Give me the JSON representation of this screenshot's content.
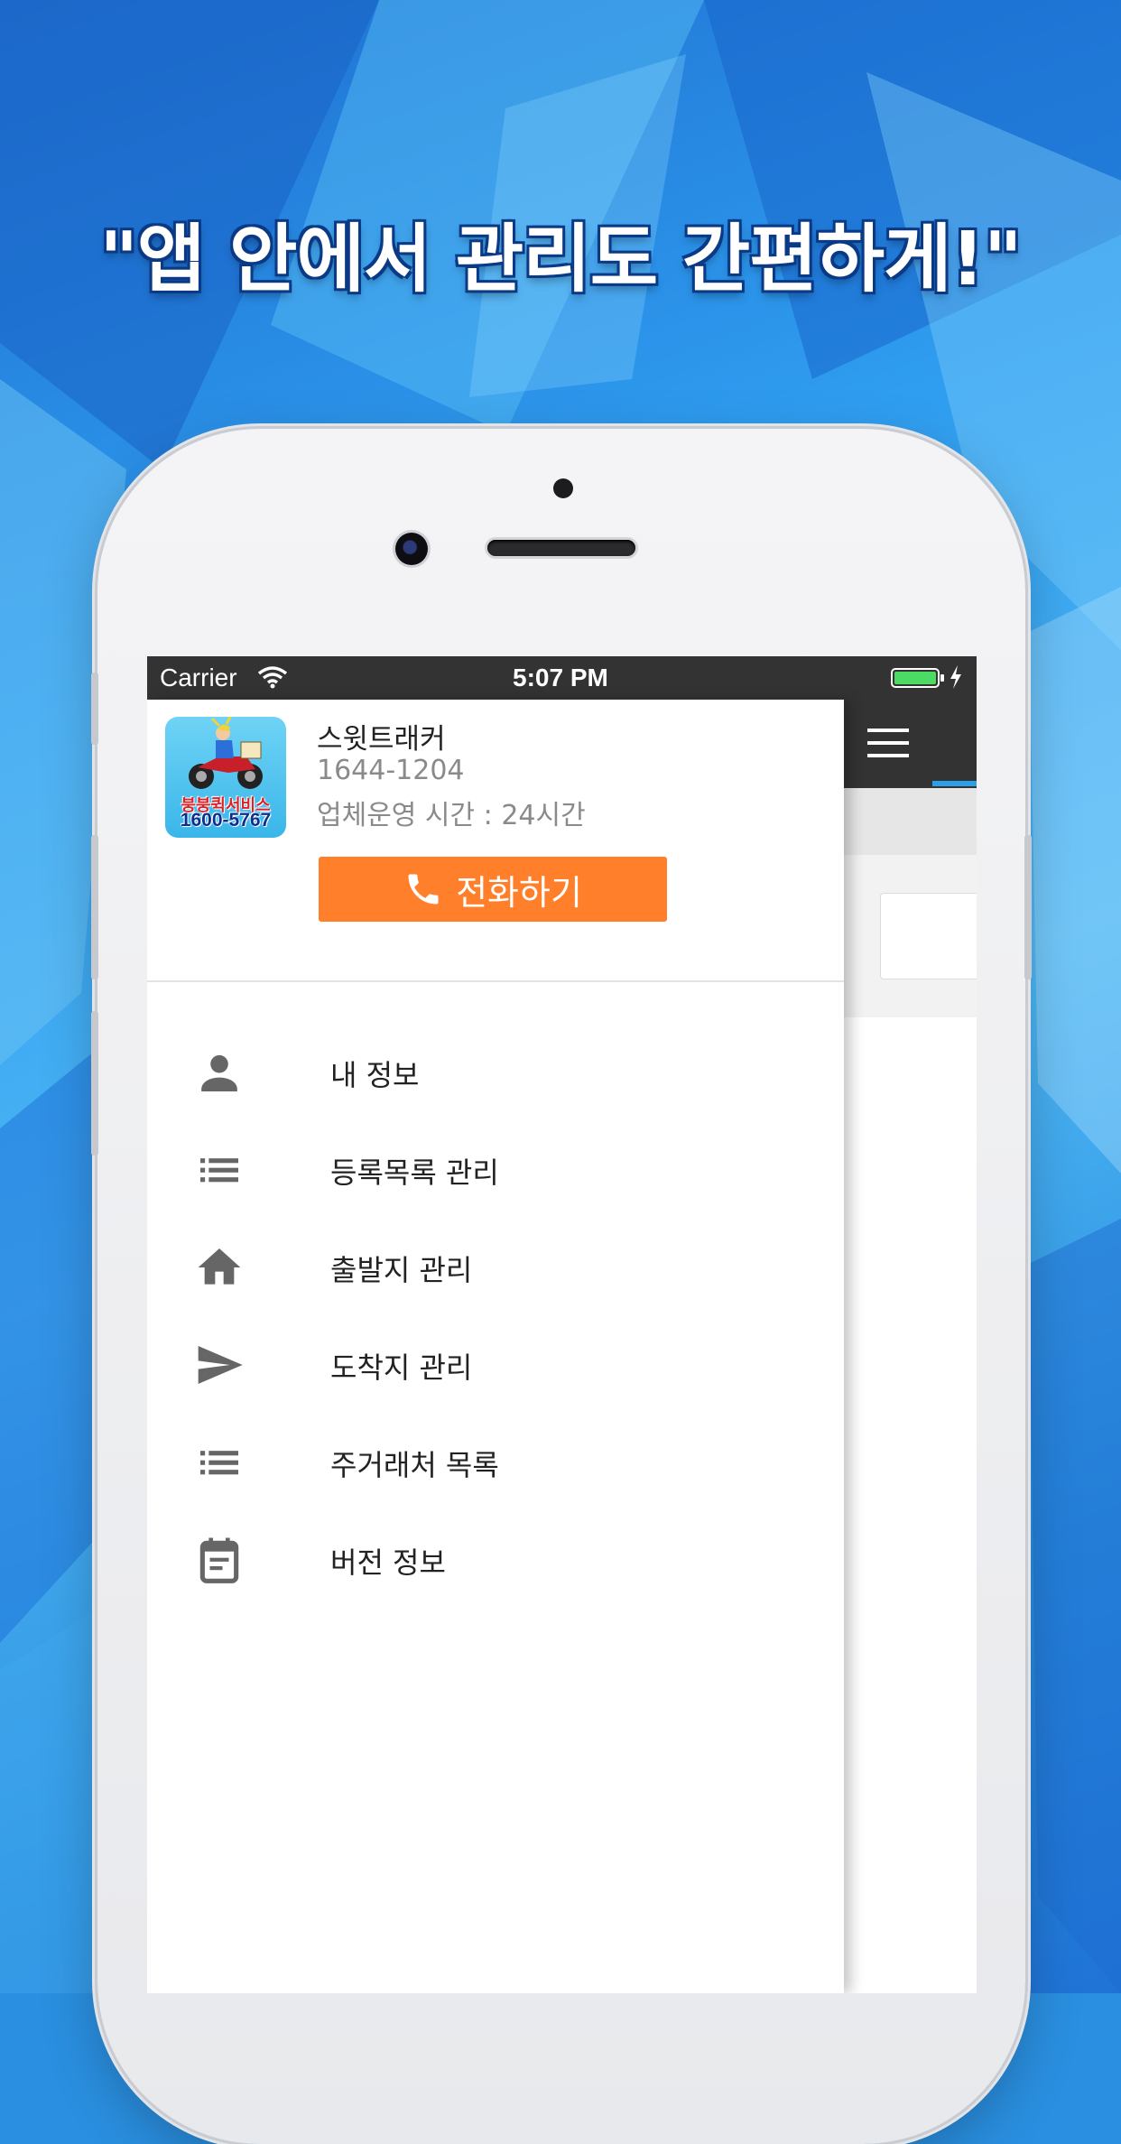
{
  "headline": "\"앱 안에서 관리도 간편하게!\"",
  "status_bar": {
    "carrier": "Carrier",
    "time": "5:07 PM"
  },
  "drawer": {
    "logo": {
      "line1": "붕붕퀵서비스",
      "line2": "1600-5767"
    },
    "company_name": "스윗트래커",
    "company_phone": "1644-1204",
    "company_hours": "업체운영 시간 : 24시간",
    "call_button_label": "전화하기",
    "menu": [
      {
        "label": "내 정보",
        "icon": "person-icon"
      },
      {
        "label": "등록목록 관리",
        "icon": "list-icon"
      },
      {
        "label": "출발지 관리",
        "icon": "home-icon"
      },
      {
        "label": "도착지 관리",
        "icon": "send-icon"
      },
      {
        "label": "주거래처 목록",
        "icon": "list-icon"
      },
      {
        "label": "버전 정보",
        "icon": "calendar-icon"
      }
    ]
  },
  "colors": {
    "accent_orange": "#ff7f2a",
    "toolbar_dark": "#333333",
    "tab_indicator_blue": "#2aa0e8",
    "battery_green": "#4cd964"
  }
}
